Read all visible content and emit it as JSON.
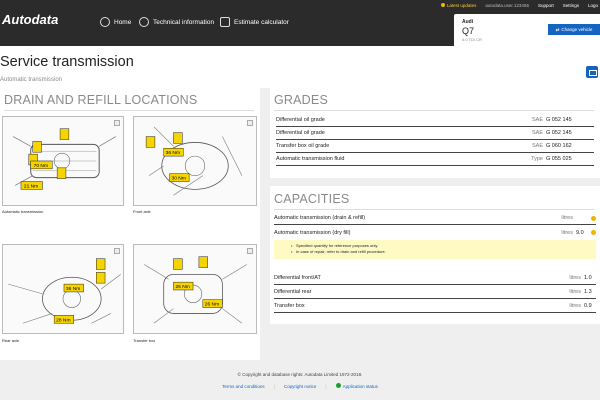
{
  "brand": {
    "logo_text": "Autodata"
  },
  "nav": {
    "home": "Home",
    "technical": "Technical information",
    "estimate": "Estimate calculator"
  },
  "util": {
    "latest_updates": "Latest updates",
    "account": "autodata.user.123456",
    "support": "Support",
    "settings": "Settings",
    "logout": "Logo"
  },
  "vehicle": {
    "make": "Audi",
    "model": "Q7",
    "engine": "4.0 TDI CR",
    "change_label": "Change vehicle"
  },
  "page": {
    "title": "Service transmission",
    "subtitle": "Automatic transmission"
  },
  "drain": {
    "title": "DRAIN AND REFILL LOCATIONS",
    "diagrams": [
      {
        "caption": "Automatic transmission",
        "labels": [
          "70 Nm",
          "21 Nm"
        ]
      },
      {
        "caption": "Front axle",
        "labels": [
          "36 Nm",
          "30 Nm"
        ]
      },
      {
        "caption": "Rear axle",
        "labels": [
          "36 Nm",
          "28 Nm"
        ]
      },
      {
        "caption": "Transfer box",
        "labels": [
          "26 Nm",
          "26 Nm"
        ]
      }
    ]
  },
  "grades": {
    "title": "GRADES",
    "rows": [
      {
        "label": "Differential oil grade",
        "unit": "SAE",
        "value": "G 052 145"
      },
      {
        "label": "Differential oil grade",
        "unit": "SAE",
        "value": "G 052 145"
      },
      {
        "label": "Transfer box oil grade",
        "unit": "SAE",
        "value": "G 060 162"
      },
      {
        "label": "Automatic transmission fluid",
        "unit": "Type",
        "value": "G 055 025"
      }
    ]
  },
  "capacities": {
    "title": "CAPACITIES",
    "rows": [
      {
        "label": "Automatic transmission (drain & refill)",
        "unit": "litres",
        "value": ""
      },
      {
        "label": "Automatic transmission (dry fill)",
        "unit": "litres",
        "value": "9.0"
      },
      {
        "label": "Differential front/AT",
        "unit": "litres",
        "value": "1.0"
      },
      {
        "label": "Differential rear",
        "unit": "litres",
        "value": "1.3"
      },
      {
        "label": "Transfer box",
        "unit": "litres",
        "value": "0.9"
      }
    ],
    "notes": [
      "Specified quantity for reference purposes only.",
      "In case of repair, refer to drain and refill procedure."
    ]
  },
  "footer": {
    "copyright": "© Copyright and database rights: Autodata Limited 1972-2018.",
    "terms": "Terms and conditions",
    "sep": "|",
    "copyright_notice": "Copyright notice",
    "status": "Application status"
  },
  "colors": {
    "accent": "#1565c0",
    "topbar": "#2b2b2b",
    "marker": "#f5d400",
    "note_bg": "#fff9c4"
  }
}
